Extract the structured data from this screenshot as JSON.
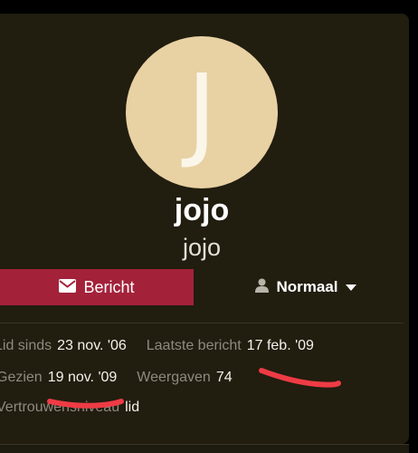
{
  "profile": {
    "avatar_letter": "J",
    "avatar_color": "#e8d1a3",
    "username": "jojo",
    "display_name": "jojo"
  },
  "actions": {
    "message_label": "Bericht",
    "message_icon": "envelope-icon",
    "message_color": "#a3223a",
    "status_label": "Normaal",
    "status_icon": "user-icon",
    "status_dropdown_icon": "caret-down-icon"
  },
  "stats": {
    "member_since_label": "Lid sinds",
    "member_since_value": "23 nov. '06",
    "last_post_label": "Laatste bericht",
    "last_post_value": "17 feb. '09",
    "seen_label": "Gezien",
    "seen_value": "19 nov. '09",
    "views_label": "Weergaven",
    "views_value": "74",
    "trust_label": "Vertrouwensniveau",
    "trust_value": "lid"
  },
  "annotation_color": "#ee3b45"
}
